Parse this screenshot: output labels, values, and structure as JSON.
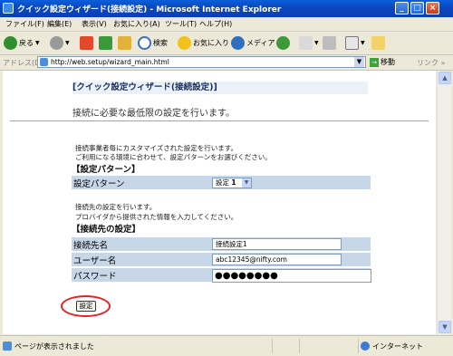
{
  "window": {
    "title": "クイック設定ウィザード(接続設定) - Microsoft Internet Explorer",
    "minimize": "_",
    "maximize": "□",
    "close": "×"
  },
  "menu": [
    "ファイル(F)",
    "編集(E)",
    "表示(V)",
    "お気に入り(A)",
    "ツール(T)",
    "ヘルプ(H)"
  ],
  "toolbar": {
    "back": "戻る",
    "search": "検索",
    "favorites": "お気に入り",
    "media": "メディア"
  },
  "address": {
    "label": "アドレス(D)",
    "url": "http://web.setup/wizard_main.html",
    "go": "移動",
    "links": "リンク »"
  },
  "page": {
    "title": "[クイック設定ウィザード(接続設定)]",
    "subtitle": "接続に必要な最低限の設定を行います。",
    "pattern_desc1": "接続事業者毎にカスタマイズされた設定を行います。",
    "pattern_desc2": "ご利用になる環境に合わせて、設定パターンをお選びください。",
    "pattern_heading": "【設定パターン】",
    "pattern_label": "設定パターン",
    "pattern_value_prefix": "設定",
    "pattern_value_num": "1",
    "conn_desc1": "接続先の設定を行います。",
    "conn_desc2": "プロバイダから提供された情報を入力してください。",
    "conn_heading": "【接続先の設定】",
    "conn_name_label": "接続先名",
    "conn_name_value": "接続設定1",
    "user_label": "ユーザー名",
    "user_value": "abc12345@nifty.com",
    "password_label": "パスワード",
    "password_value": "●●●●●●●●",
    "submit": "設定"
  },
  "status": {
    "text": "ページが表示されました",
    "zone": "インターネット"
  }
}
